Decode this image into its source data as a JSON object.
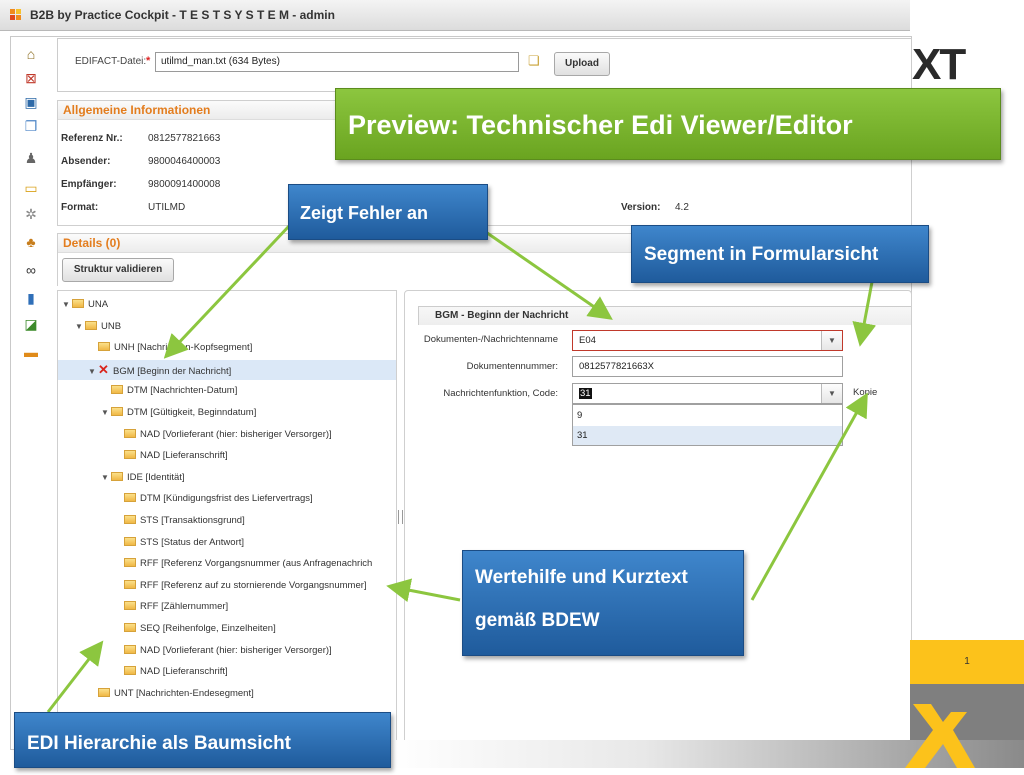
{
  "window": {
    "title": "B2B by Practice Cockpit - T E S T S Y S T E M - admin"
  },
  "sidebar_icons": [
    "home-icon",
    "chart-icon",
    "monitor-icon",
    "pages-icon",
    "user-warning-icon",
    "lock-icon",
    "gear-icon",
    "users-icon",
    "binoculars-icon",
    "bar-chart-icon",
    "chart-edit-icon",
    "card-icon"
  ],
  "upload": {
    "label": "EDIFACT-Datei:",
    "required_mark": "*",
    "file_value": "utilmd_man.txt (634 Bytes)",
    "upload_button": "Upload"
  },
  "general": {
    "header": "Allgemeine Informationen",
    "rows": [
      {
        "label": "Referenz Nr.:",
        "value": "0812577821663"
      },
      {
        "label": "Absender:",
        "value": "9800046400003"
      },
      {
        "label": "Empfänger:",
        "value": "9800091400008"
      },
      {
        "label": "Format:",
        "value": "UTILMD"
      }
    ],
    "version_label": "Version:",
    "version_value": "4.2"
  },
  "details": {
    "header": "Details (0)",
    "validate_button": "Struktur validieren"
  },
  "tree": {
    "nodes": [
      {
        "label": "UNA",
        "toggle": "▼"
      },
      {
        "label": "UNB",
        "toggle": "▼"
      },
      {
        "label": "UNH [Nachrichten-Kopfsegment]",
        "toggle": ""
      },
      {
        "label": "BGM [Beginn der Nachricht]",
        "toggle": "▼"
      },
      {
        "label": "DTM [Nachrichten-Datum]",
        "toggle": ""
      },
      {
        "label": "DTM [Gültigkeit, Beginndatum]",
        "toggle": "▼"
      },
      {
        "label": "NAD [Vorlieferant (hier: bisheriger Versorger)]",
        "toggle": ""
      },
      {
        "label": "NAD [Lieferanschrift]",
        "toggle": ""
      },
      {
        "label": "IDE [Identität]",
        "toggle": "▼"
      },
      {
        "label": "DTM [Kündigungsfrist des Liefervertrags]",
        "toggle": ""
      },
      {
        "label": "STS [Transaktionsgrund]",
        "toggle": ""
      },
      {
        "label": "STS [Status der Antwort]",
        "toggle": ""
      },
      {
        "label": "RFF [Referenz Vorgangsnummer (aus Anfragenachrich",
        "toggle": ""
      },
      {
        "label": "RFF [Referenz auf zu stornierende Vorgangsnummer]",
        "toggle": ""
      },
      {
        "label": "RFF [Zählernummer]",
        "toggle": ""
      },
      {
        "label": "SEQ [Reihenfolge, Einzelheiten]",
        "toggle": ""
      },
      {
        "label": "NAD [Vorlieferant (hier: bisheriger Versorger)]",
        "toggle": ""
      },
      {
        "label": "NAD [Lieferanschrift]",
        "toggle": ""
      },
      {
        "label": "UNT [Nachrichten-Endesegment]",
        "toggle": ""
      }
    ]
  },
  "segment_form": {
    "legend": "BGM - Beginn der Nachricht",
    "fields": [
      {
        "label": "Dokumenten-/Nachrichtenname",
        "value": "E04"
      },
      {
        "label": "Dokumentennummer:",
        "value": "0812577821663X"
      },
      {
        "label": "Nachrichtenfunktion, Code:",
        "value": "31"
      }
    ],
    "short_text": "Kopie",
    "dropdown_options": [
      "9",
      "31"
    ]
  },
  "callouts": {
    "preview": "Preview: Technischer Edi Viewer/Editor",
    "errors": "Zeigt  Fehler an",
    "segment": "Segment in Formularsicht",
    "valuehelp_line1": "Wertehilfe und Kurztext",
    "valuehelp_line2": "gemäß  BDEW",
    "hierarchy": "EDI Hierarchie als Baumsicht"
  },
  "brand": {
    "logo_text": "XT"
  },
  "slide": {
    "page_number": "1"
  },
  "colors": {
    "accent_orange": "#e37d1e",
    "callout_blue": "#2a6db5",
    "callout_green": "#7ab52e",
    "brand_yellow": "#fcc21b"
  }
}
